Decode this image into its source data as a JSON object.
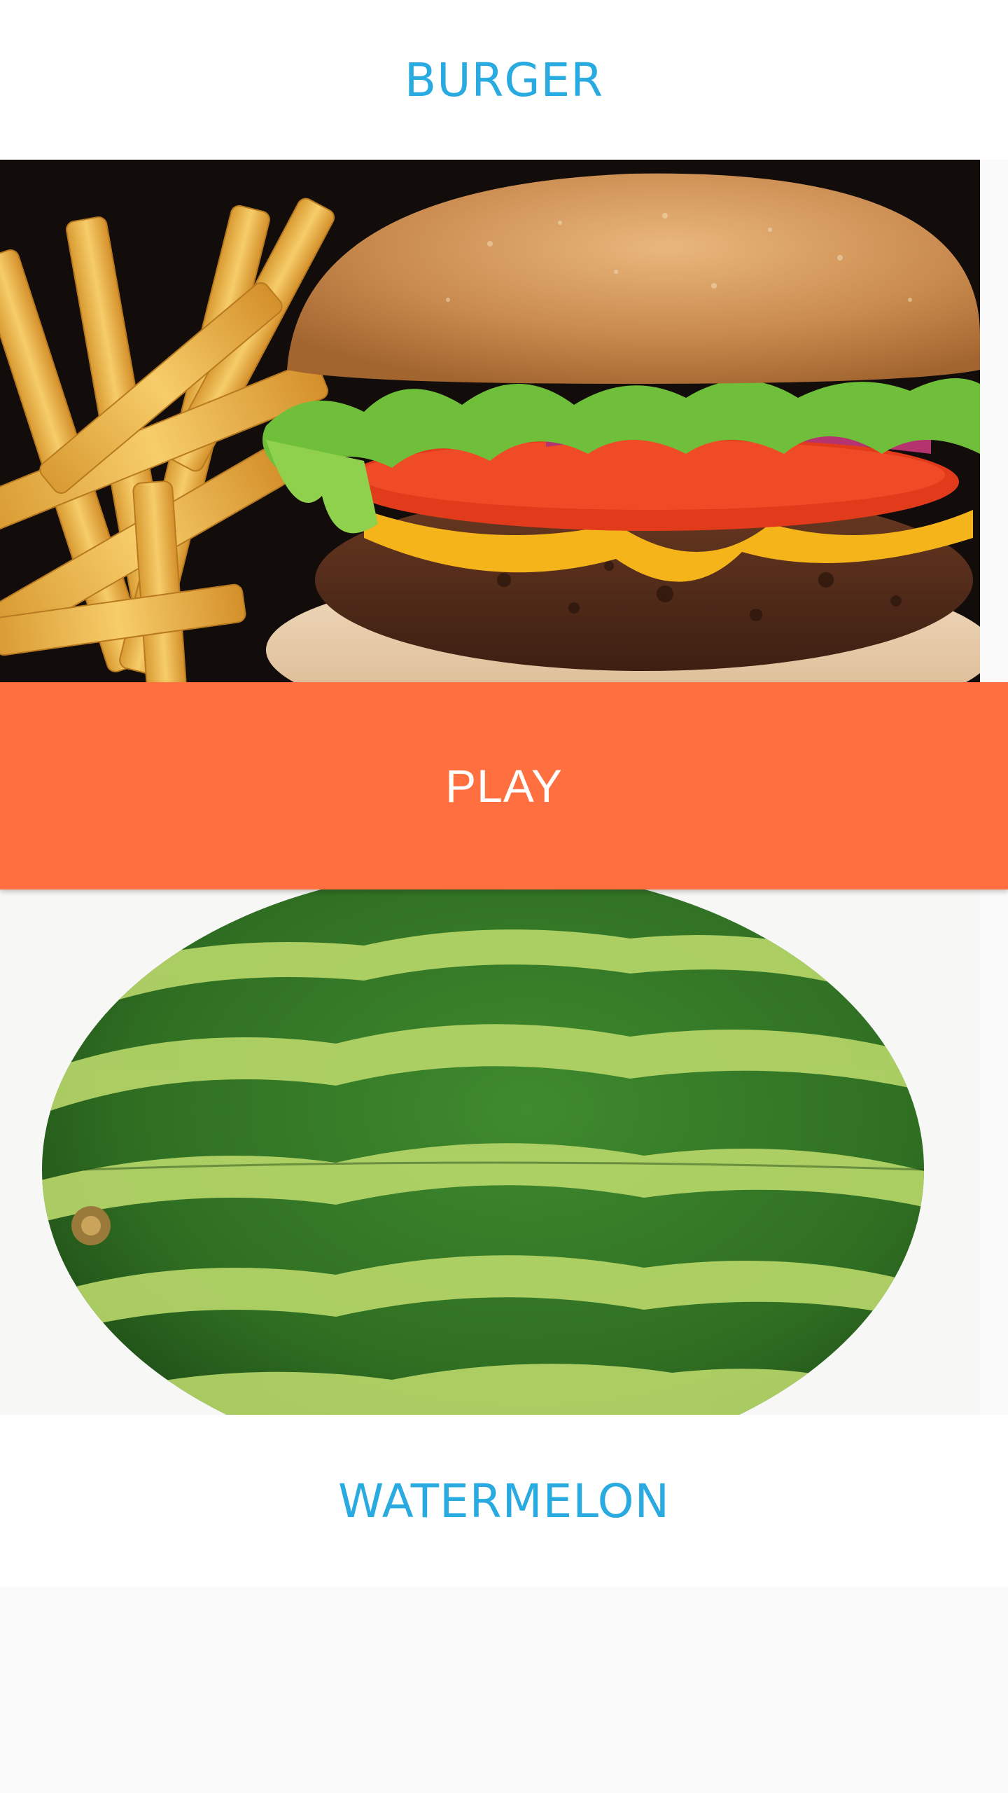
{
  "top_item": {
    "title": "BURGER",
    "image_subject": "burger-with-fries"
  },
  "play_button": {
    "label": "PLAY"
  },
  "bottom_item": {
    "title": "WATERMELON",
    "image_subject": "watermelon"
  },
  "colors": {
    "title_text": "#29abe2",
    "play_background": "#ff6f3f",
    "play_text": "#ffffff",
    "page_background": "#fafafa"
  }
}
